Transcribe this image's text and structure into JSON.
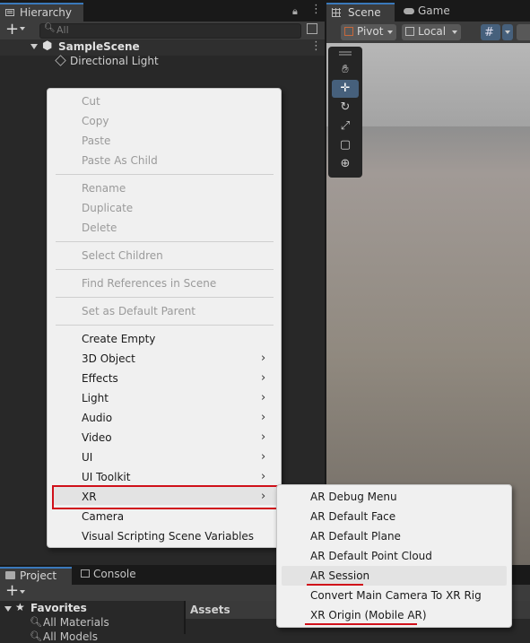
{
  "hierarchy": {
    "tab_label": "Hierarchy",
    "search_placeholder": "All",
    "scene_name": "SampleScene",
    "objects": [
      "Directional Light"
    ]
  },
  "scene_view": {
    "tabs": [
      "Scene",
      "Game"
    ],
    "pivot_label": "Pivot",
    "local_label": "Local"
  },
  "context_menu": {
    "groups": [
      [
        {
          "label": "Cut",
          "enabled": false
        },
        {
          "label": "Copy",
          "enabled": false
        },
        {
          "label": "Paste",
          "enabled": false
        },
        {
          "label": "Paste As Child",
          "enabled": false
        }
      ],
      [
        {
          "label": "Rename",
          "enabled": false
        },
        {
          "label": "Duplicate",
          "enabled": false
        },
        {
          "label": "Delete",
          "enabled": false
        }
      ],
      [
        {
          "label": "Select Children",
          "enabled": false
        }
      ],
      [
        {
          "label": "Find References in Scene",
          "enabled": false
        }
      ],
      [
        {
          "label": "Set as Default Parent",
          "enabled": false
        }
      ],
      [
        {
          "label": "Create Empty",
          "enabled": true
        },
        {
          "label": "3D Object",
          "enabled": true,
          "submenu": true
        },
        {
          "label": "Effects",
          "enabled": true,
          "submenu": true
        },
        {
          "label": "Light",
          "enabled": true,
          "submenu": true
        },
        {
          "label": "Audio",
          "enabled": true,
          "submenu": true
        },
        {
          "label": "Video",
          "enabled": true,
          "submenu": true
        },
        {
          "label": "UI",
          "enabled": true,
          "submenu": true
        },
        {
          "label": "UI Toolkit",
          "enabled": true,
          "submenu": true
        },
        {
          "label": "XR",
          "enabled": true,
          "submenu": true,
          "highlighted": true
        },
        {
          "label": "Camera",
          "enabled": true
        },
        {
          "label": "Visual Scripting Scene Variables",
          "enabled": true
        }
      ]
    ]
  },
  "xr_submenu": {
    "items": [
      {
        "label": "AR Debug Menu"
      },
      {
        "label": "AR Default Face"
      },
      {
        "label": "AR Default Plane"
      },
      {
        "label": "AR Default Point Cloud"
      },
      {
        "label": "AR Session",
        "highlighted": true,
        "underlined": true
      },
      {
        "label": "Convert Main Camera To XR Rig"
      },
      {
        "label": "XR Origin (Mobile AR)",
        "underlined": true
      }
    ]
  },
  "project": {
    "tabs": [
      "Project",
      "Console"
    ],
    "favorites_label": "Favorites",
    "favorites": [
      "All Materials",
      "All Models"
    ],
    "assets_label": "Assets"
  },
  "colors": {
    "annotation_red": "#d0101a",
    "selection_blue": "#3a79bb"
  }
}
